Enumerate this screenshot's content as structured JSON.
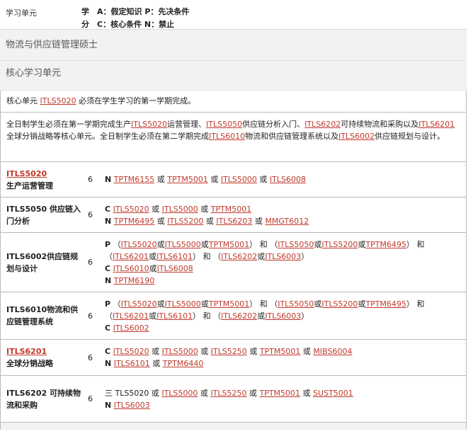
{
  "header": {
    "label": "学习单元",
    "chars": [
      "学",
      "分"
    ],
    "legend": [
      "A：假定知识 P：先决条件",
      "C：核心条件 N：禁止"
    ]
  },
  "sections": {
    "program": "物流与供应链管理硕士",
    "core": "核心学习单元"
  },
  "note1": {
    "pre": "核心单元 ",
    "link": "ITLS5020",
    "post": " 必须在学生学习的第一学期完成。"
  },
  "note2": {
    "t1": "全日制学生必须在第一学期完成生产",
    "l1": "ITLS5020",
    "t2": "运营管理、",
    "l2": "ITLS5050",
    "t3": "供应链分析入门、",
    "l3": "ITLS6202",
    "t4": "可持续物流和采购以及",
    "l4": "ITLS6201",
    "t5": "全球分销战略等核心单元。全日制学生必须在第二学期完成",
    "l5": "ITLS6010",
    "t6": "物流和供应链管理系统以及",
    "l6": "ITLS6002",
    "t7": "供应链规划与设计。"
  },
  "rows": [
    {
      "code": "ITLS5020",
      "name": "生产运营管理",
      "credits": "6"
    },
    {
      "name": "ITLS5050 供应链入门分析",
      "credits": "6"
    },
    {
      "name": "ITLS6002供应链规划与设计",
      "credits": "6"
    },
    {
      "name": "ITLS6010物流和供应链管理系统",
      "credits": "6"
    },
    {
      "code": "ITLS6201",
      "name": "全球分销战略",
      "credits": "6"
    },
    {
      "name": "ITLS6202 可持续物流和采购",
      "credits": "6"
    }
  ],
  "labels": {
    "N": "N",
    "C": "C",
    "P": "P",
    "or": "或",
    "and": "和",
    "open": "（",
    "close": "）",
    "san": "三"
  },
  "codes": {
    "TPTM6155": "TPTM6155",
    "TPTM5001": "TPTM5001",
    "ITLS5000": "ITLS5000",
    "ITLS6008": "ITLS6008",
    "ITLS5020": "ITLS5020",
    "TPTM6495": "TPTM6495",
    "ITLS5200": "ITLS5200",
    "ITLS6203": "ITLS6203",
    "MMGT6012": "MMGT6012",
    "ITLS5050": "ITLS5050",
    "ITLS6201": "ITLS6201",
    "ITLS6101": "ITLS6101",
    "ITLS6202": "ITLS6202",
    "ITLS6003": "ITLS6003",
    "ITLS6010": "ITLS6010",
    "TPTM6190": "TPTM6190",
    "ITLS6002": "ITLS6002",
    "ITLS5250": "ITLS5250",
    "MIBS6004": "MIBS6004",
    "TPTM6440": "TPTM6440",
    "SUST5001": "SUST5001"
  },
  "plain_text": {
    "TLS5020": "TLS5020"
  }
}
